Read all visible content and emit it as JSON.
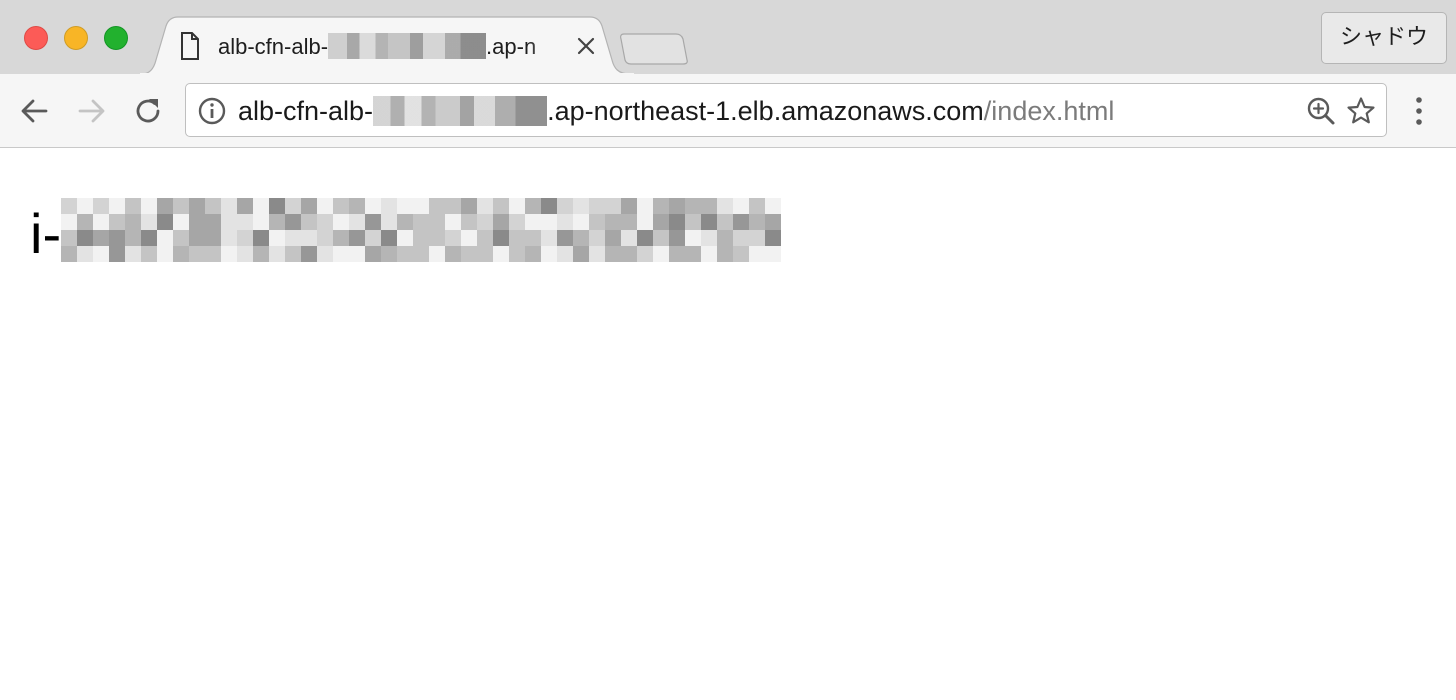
{
  "browser": {
    "tab": {
      "title_prefix": "alb-cfn-alb-",
      "title_suffix": ".ap-n"
    },
    "profile_button": "シャドウ",
    "address_bar": {
      "url_host_prefix": "alb-cfn-alb-",
      "url_host_suffix": ".ap-northeast-1.elb.amazonaws.com",
      "url_path": "/index.html"
    },
    "icons": {
      "tab": "document-icon",
      "tab_close": "close-icon",
      "back": "back-arrow-icon",
      "forward": "forward-arrow-icon",
      "reload": "reload-icon",
      "site_info": "info-icon",
      "zoom": "zoom-in-icon",
      "bookmark": "star-icon",
      "menu": "kebab-menu-icon"
    }
  },
  "page": {
    "text_prefix": "i-"
  },
  "colors": {
    "close": "#fc5b57",
    "minimize": "#f8b526",
    "maximize": "#22b12e",
    "titlebar": "#d8d8d8",
    "toolbar": "#f6f6f6",
    "url_path": "#7b7b7b"
  }
}
